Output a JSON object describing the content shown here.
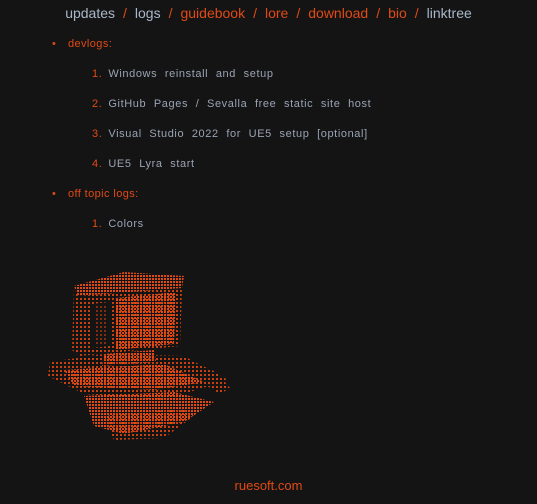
{
  "nav": {
    "items": [
      {
        "label": "updates",
        "color": "#a9b7c9"
      },
      {
        "label": "logs",
        "color": "#a9b7c9"
      },
      {
        "label": "guidebook",
        "color": "#e04a14"
      },
      {
        "label": "lore",
        "color": "#e04a14"
      },
      {
        "label": "download",
        "color": "#e04a14"
      },
      {
        "label": "bio",
        "color": "#e04a14"
      },
      {
        "label": "linktree",
        "color": "#a9b7c9"
      }
    ],
    "separator": "/"
  },
  "sections": [
    {
      "title": "devlogs:",
      "items": [
        {
          "num": "1.",
          "label": "Windows reinstall and setup"
        },
        {
          "num": "2.",
          "label": "GitHub Pages / Sevalla free static site host"
        },
        {
          "num": "3.",
          "label": "Visual Studio 2022 for UE5 setup [optional]"
        },
        {
          "num": "4.",
          "label": "UE5 Lyra start"
        }
      ]
    },
    {
      "title": "off topic logs:",
      "items": [
        {
          "num": "1.",
          "label": "Colors"
        }
      ]
    }
  ],
  "colors": {
    "background": "#141414",
    "accent": "#e04a14",
    "link_muted": "#a9b7c9",
    "text_muted": "#9aa4b4"
  },
  "art": {
    "icon": "ascii-computer-icon"
  },
  "footer": {
    "label": "ruesoft.com"
  }
}
